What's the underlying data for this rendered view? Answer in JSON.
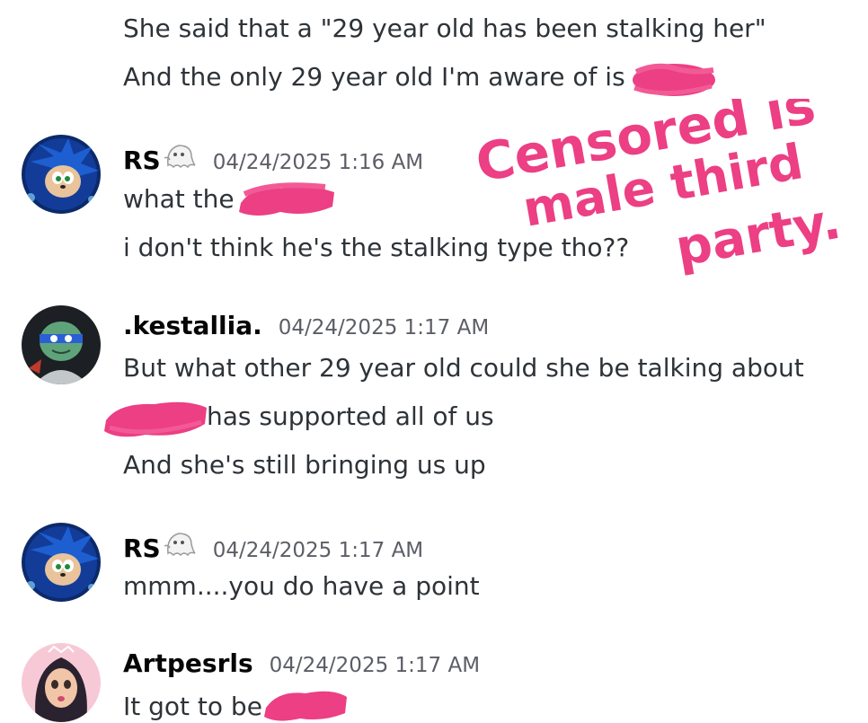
{
  "colors": {
    "redaction": "#ec3f84",
    "username": "#060607",
    "timestamp": "#5c5e66",
    "message": "#2e3338"
  },
  "messages": {
    "m0": {
      "lines": [
        "She said that a \"29 year old has been stalking her\"",
        "And the only 29 year old I'm aware of is"
      ]
    },
    "m1": {
      "author": "RS",
      "badge_icon": "ghost-icon",
      "timestamp": "04/24/2025 1:16 AM",
      "lines": [
        "what the",
        "i don't think he's the stalking type tho??"
      ]
    },
    "m2": {
      "author": ".kestallia.",
      "timestamp": "04/24/2025 1:17 AM",
      "lines": [
        "But what other 29 year old could she be talking about",
        "has supported all of us",
        "And she's still bringing us up"
      ]
    },
    "m3": {
      "author": "RS",
      "badge_icon": "ghost-icon",
      "timestamp": "04/24/2025 1:17 AM",
      "lines": [
        "mmm....you do have a point"
      ]
    },
    "m4": {
      "author": "Artpesrls",
      "timestamp": "04/24/2025 1:17 AM",
      "lines": [
        "It got to be"
      ]
    }
  },
  "annotation": {
    "line1": "Censored is",
    "line2": "male third",
    "line3": "party."
  }
}
